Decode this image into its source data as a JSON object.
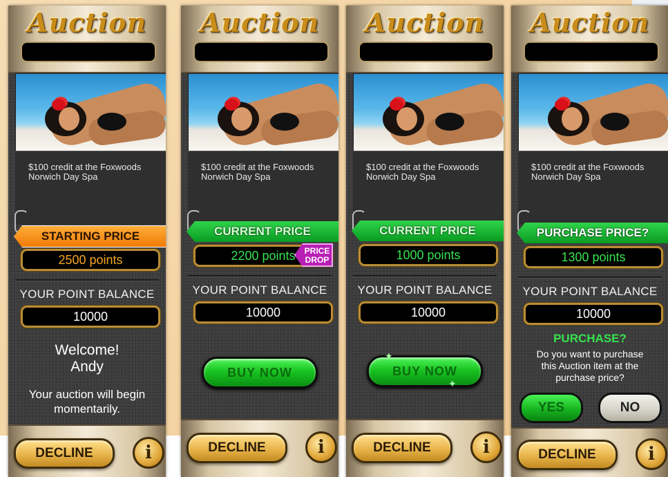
{
  "logo_text": "Auction",
  "item_description": "$100 credit at the Foxwoods Norwich Day Spa",
  "balance_label": "YOUR POINT BALANCE",
  "balance_value": "10000",
  "decline_label": "DECLINE",
  "info_label": "i",
  "screens": [
    {
      "tag_label": "STARTING PRICE",
      "price": "2500 points",
      "welcome_line1": "Welcome!",
      "welcome_line2": "Andy",
      "message": "Your auction will begin momentarily."
    },
    {
      "tag_label": "CURRENT PRICE",
      "price": "2200 points",
      "badge": "PRICE DROP",
      "buy_label": "BUY NOW"
    },
    {
      "tag_label": "CURRENT PRICE",
      "price": "1000 points",
      "buy_label": "BUY NOW"
    },
    {
      "tag_label": "PURCHASE PRICE?",
      "price": "1300 points",
      "question_title": "PURCHASE?",
      "question_text": "Do you want to purchase this Auction item at the purchase price?",
      "yes_label": "YES",
      "no_label": "NO"
    }
  ],
  "colors": {
    "starting_tag": "#f59a1e",
    "current_tag": "#17b82f",
    "price_drop_badge": "#b81fb5",
    "gold_trim": "#b98d35"
  }
}
